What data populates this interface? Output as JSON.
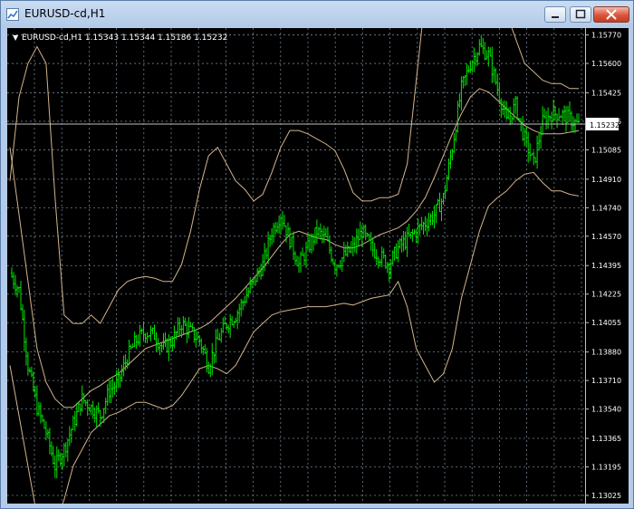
{
  "window": {
    "title": "EURUSD-cd,H1"
  },
  "header": {
    "arrow": "▼",
    "text": "EURUSD-cd,H1  1.15343 1.15344 1.15186 1.15232"
  },
  "price_axis": {
    "labels": [
      "1.15770",
      "1.15600",
      "1.15425",
      "1.15255",
      "1.15085",
      "1.14910",
      "1.14740",
      "1.14570",
      "1.14395",
      "1.14225",
      "1.14055",
      "1.13880",
      "1.13710",
      "1.13540",
      "1.13365",
      "1.13195",
      "1.13025"
    ],
    "current_price": "1.15232"
  },
  "colors": {
    "background": "#000000",
    "candles": "#00e600",
    "bands": "#d2b48c",
    "grid": "#708090",
    "axis_text": "#ffffff"
  },
  "chart_data": {
    "type": "line",
    "symbol": "EURUSD-cd",
    "timeframe": "H1",
    "last_bar": {
      "open": 1.15343,
      "high": 1.15344,
      "low": 1.15186,
      "close": 1.15232
    },
    "ylim": [
      1.13025,
      1.158
    ],
    "grid": true,
    "series": [
      {
        "values": [
          1.1435,
          1.1425,
          1.138,
          1.1355,
          1.134,
          1.132,
          1.133,
          1.1345,
          1.136,
          1.1355,
          1.135,
          1.1365,
          1.137,
          1.1385,
          1.1395,
          1.14,
          1.1398,
          1.139,
          1.1395,
          1.1405,
          1.14,
          1.1395,
          1.138,
          1.1395,
          1.1405,
          1.141,
          1.142,
          1.143,
          1.144,
          1.146,
          1.147,
          1.1455,
          1.144,
          1.145,
          1.146,
          1.1455,
          1.144,
          1.1445,
          1.145,
          1.146,
          1.145,
          1.1445,
          1.144,
          1.145,
          1.1455,
          1.146,
          1.1465,
          1.147,
          1.148,
          1.151,
          1.1545,
          1.156,
          1.157,
          1.1565,
          1.1545,
          1.1525,
          1.1535,
          1.1515,
          1.15,
          1.1525,
          1.153,
          1.153,
          1.1527,
          1.1523
        ]
      },
      {
        "values": [
          1.151,
          1.147,
          1.143,
          1.139,
          1.137,
          1.136,
          1.1355,
          1.1355,
          1.136,
          1.1365,
          1.1368,
          1.1372,
          1.1375,
          1.138,
          1.1385,
          1.139,
          1.1392,
          1.1394,
          1.1396,
          1.1398,
          1.14,
          1.1402,
          1.1405,
          1.141,
          1.1415,
          1.142,
          1.1426,
          1.1432,
          1.1438,
          1.1445,
          1.1452,
          1.1458,
          1.146,
          1.1458,
          1.1456,
          1.1455,
          1.1452,
          1.145,
          1.145,
          1.1452,
          1.1455,
          1.1458,
          1.146,
          1.1462,
          1.1466,
          1.1472,
          1.148,
          1.1492,
          1.1505,
          1.1518,
          1.153,
          1.154,
          1.1545,
          1.1543,
          1.1538,
          1.1533,
          1.1528,
          1.1523,
          1.152,
          1.1518,
          1.1518,
          1.1518,
          1.1519,
          1.152
        ]
      },
      {
        "values": [
          1.149,
          1.154,
          1.156,
          1.157,
          1.156,
          1.148,
          1.141,
          1.1405,
          1.1405,
          1.141,
          1.1405,
          1.1415,
          1.1425,
          1.143,
          1.1432,
          1.1433,
          1.1432,
          1.143,
          1.143,
          1.144,
          1.146,
          1.1485,
          1.1505,
          1.151,
          1.15,
          1.149,
          1.1485,
          1.1478,
          1.1482,
          1.1495,
          1.151,
          1.152,
          1.152,
          1.1518,
          1.1515,
          1.1512,
          1.1508,
          1.1497,
          1.1483,
          1.1478,
          1.1478,
          1.148,
          1.148,
          1.1482,
          1.15,
          1.155,
          1.16,
          1.164,
          1.1665,
          1.167,
          1.1665,
          1.165,
          1.163,
          1.1615,
          1.16,
          1.159,
          1.1575,
          1.156,
          1.1555,
          1.155,
          1.1548,
          1.1548,
          1.1545,
          1.1545
        ]
      },
      {
        "values": [
          1.138,
          1.135,
          1.132,
          1.129,
          1.128,
          1.1285,
          1.13,
          1.132,
          1.133,
          1.134,
          1.1345,
          1.135,
          1.1352,
          1.1355,
          1.1358,
          1.1358,
          1.1356,
          1.1354,
          1.1356,
          1.1362,
          1.137,
          1.1378,
          1.138,
          1.1378,
          1.1375,
          1.138,
          1.139,
          1.14,
          1.1405,
          1.141,
          1.1412,
          1.1413,
          1.1414,
          1.1415,
          1.1415,
          1.1415,
          1.1416,
          1.1417,
          1.1416,
          1.1418,
          1.142,
          1.1421,
          1.1422,
          1.143,
          1.1415,
          1.139,
          1.138,
          1.137,
          1.1375,
          1.139,
          1.142,
          1.144,
          1.146,
          1.1475,
          1.148,
          1.1484,
          1.149,
          1.1494,
          1.1495,
          1.1489,
          1.1484,
          1.1484,
          1.1482,
          1.1481
        ]
      }
    ]
  }
}
